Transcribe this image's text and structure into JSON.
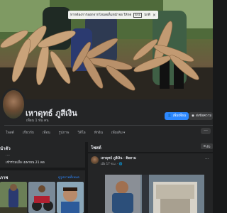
{
  "notice": {
    "text": "หากต้องการออกจากโหมดเต็มหน้าจอ ให้กด",
    "key": "Esc",
    "link": "ปกติ"
  },
  "profile": {
    "name": "เหาดุทธ์ ภูสีเงิน",
    "friends": "เพื่อน 1 พัน คน"
  },
  "actions": {
    "add_friend": "เพิ่มเพื่อน",
    "message": "ส่งข้อความ"
  },
  "tabs": [
    {
      "label": "โพสต์"
    },
    {
      "label": "เกี่ยวกับ"
    },
    {
      "label": "เพื่อน"
    },
    {
      "label": "รูปภาพ"
    },
    {
      "label": "วิดีโอ"
    },
    {
      "label": "ทักอิน"
    },
    {
      "label": "เพิ่มเติม"
    }
  ],
  "intro": {
    "title": "นำตัว",
    "rows": [
      {
        "text": "...."
      },
      {
        "text": "เข้าร่วมเมื่อ เมษายน 21 ดอ"
      }
    ]
  },
  "photos": {
    "title": "ภาพ",
    "see_all": "ดูรูปภาพทั้งหมด"
  },
  "posts": {
    "title": "โพสต์",
    "filter": "ตัว"
  },
  "post": {
    "author": "เหาดุทธ์ ภูสีเงิน · ติดตาม",
    "meta": "เมื่อ 17 ช.ม. · 🌐"
  },
  "colors": {
    "background": "#18191a",
    "card": "#242526",
    "primary": "#2d88ff",
    "text": "#e4e6eb",
    "secondary_text": "#b0b3b8"
  }
}
